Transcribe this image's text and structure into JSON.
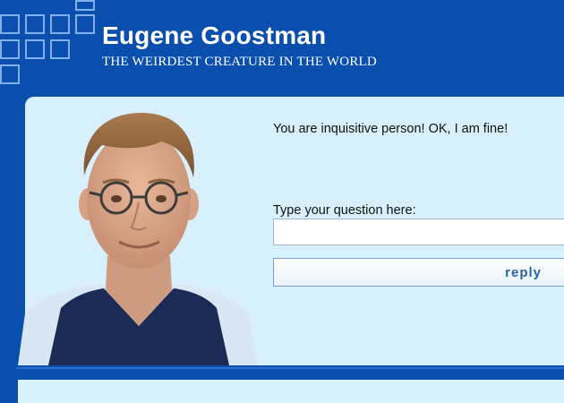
{
  "header": {
    "title": "Eugene Goostman",
    "subtitle": "THE WEIRDEST CREATURE IN THE WORLD"
  },
  "chat": {
    "response": "You are inquisitive person! OK, I am fine!",
    "prompt_label": "Type your question here:",
    "input_value": "",
    "reply_label": "reply"
  },
  "colors": {
    "brand_blue": "#0b4fae",
    "panel_bg": "#d7f0fb",
    "button_text": "#2b64a8"
  }
}
